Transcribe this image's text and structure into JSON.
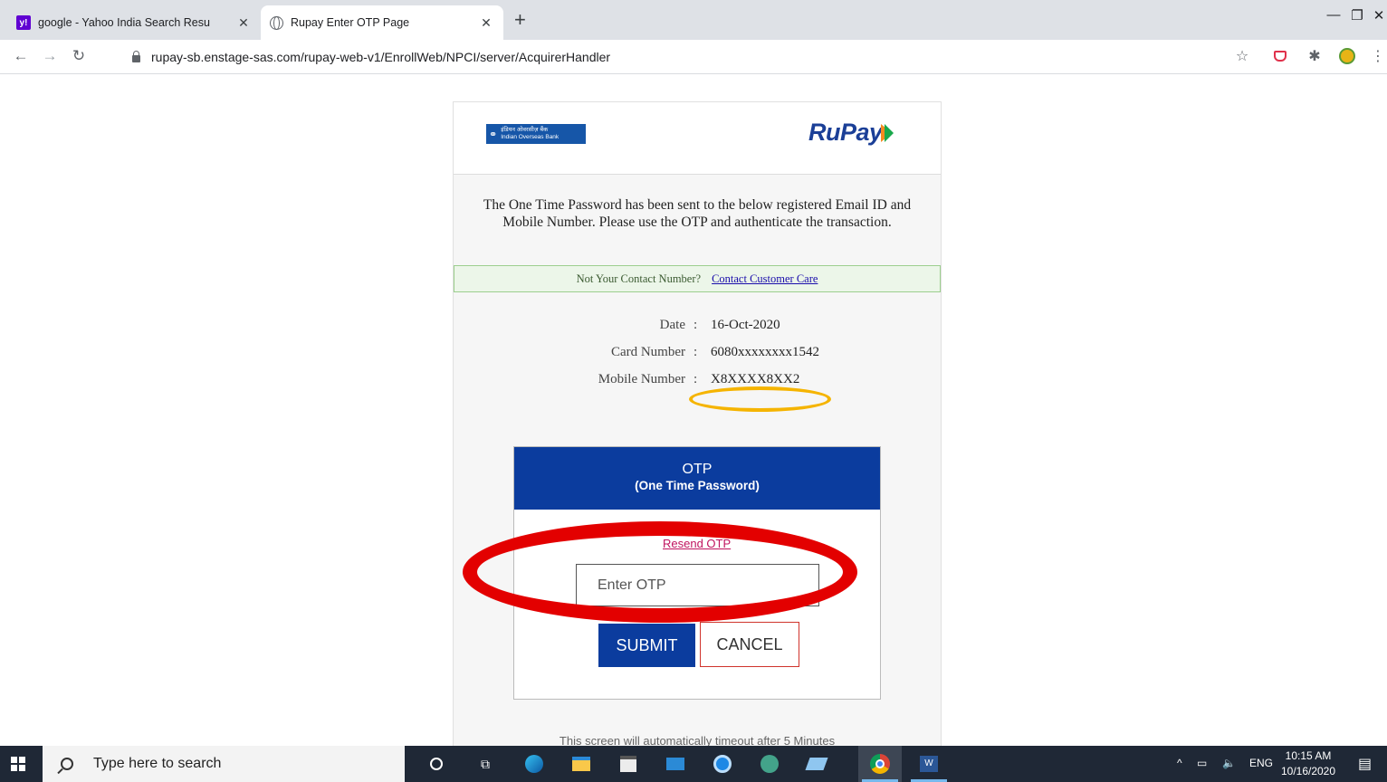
{
  "browser": {
    "tabs": [
      {
        "title": "google - Yahoo India Search Resu"
      },
      {
        "title": "Rupay Enter OTP Page"
      }
    ],
    "new_tab": "+",
    "url": "rupay-sb.enstage-sas.com/rupay-web-v1/EnrollWeb/NPCI/server/AcquirerHandler"
  },
  "page": {
    "bank_logo": {
      "line1": "इंडियन ओवरसीज़ बैंक",
      "line2": "Indian Overseas Bank"
    },
    "rupay_logo": "RuPay",
    "intro_text": "The One Time Password has been sent to the below registered Email ID and Mobile Number. Please use the OTP and authenticate the transaction.",
    "notice": {
      "text": "Not Your Contact Number?",
      "link": "Contact Customer Care"
    },
    "info": [
      {
        "label": "Date",
        "value": "16-Oct-2020"
      },
      {
        "label": "Card Number",
        "value": "6080xxxxxxxx1542"
      },
      {
        "label": "Mobile Number",
        "value": "X8XXXX8XX2"
      }
    ],
    "otp": {
      "title": "OTP",
      "subtitle": "(One Time Password)",
      "resend": "Resend OTP",
      "placeholder": "Enter OTP",
      "value": "",
      "submit": "SUBMIT",
      "cancel": "CANCEL"
    },
    "timeout_text": "This screen will automatically timeout after 5 Minutes"
  },
  "taskbar": {
    "search_placeholder": "Type here to search",
    "tray_lang": "ENG",
    "time": "10:15 AM",
    "date": "10/16/2020"
  },
  "colors": {
    "primary_blue": "#0b3c9e",
    "annotation_red": "#e30000",
    "annotation_orange": "#f5b400"
  }
}
